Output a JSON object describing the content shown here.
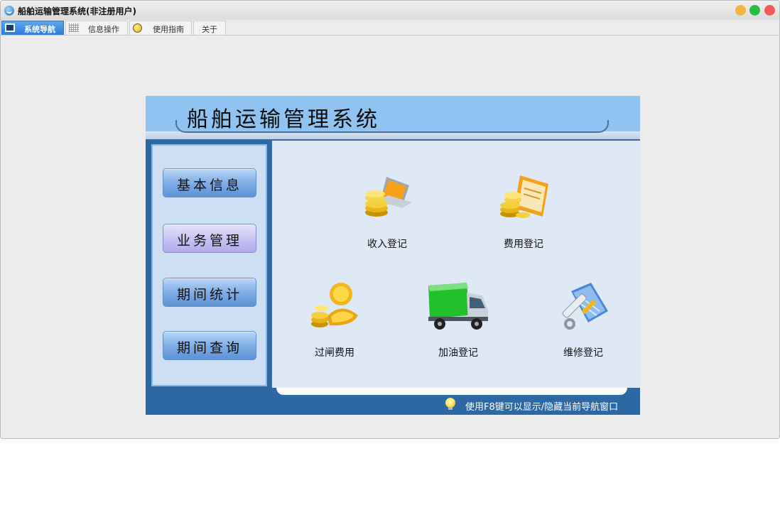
{
  "window": {
    "title": "船舶运输管理系统(非注册用户)"
  },
  "tabs": [
    {
      "label": "系统导航",
      "icon": "monitor-icon",
      "active": true
    },
    {
      "label": "信息操作",
      "icon": "grid-icon",
      "active": false
    },
    {
      "label": "使用指南",
      "icon": "help-icon",
      "active": false
    },
    {
      "label": "关于",
      "icon": "",
      "active": false
    }
  ],
  "banner": {
    "title": "船舶运输管理系统"
  },
  "sidebar": {
    "items": [
      {
        "label": "基本信息",
        "selected": false
      },
      {
        "label": "业务管理",
        "selected": true
      },
      {
        "label": "期间统计",
        "selected": false
      },
      {
        "label": "期间查询",
        "selected": false
      }
    ]
  },
  "functions": [
    {
      "label": "收入登记",
      "icon": "laptop-coins-icon"
    },
    {
      "label": "费用登记",
      "icon": "coins-document-icon"
    },
    {
      "label": "过闸费用",
      "icon": "gold-coins-icon"
    },
    {
      "label": "加油登记",
      "icon": "truck-icon"
    },
    {
      "label": "维修登记",
      "icon": "wrench-document-icon"
    }
  ],
  "footer": {
    "hint": "使用F8键可以显示/隐藏当前导航窗口",
    "icon": "lightbulb-icon"
  },
  "colors": {
    "accent": "#2a7ddb",
    "panel_blue": "#2b68a4",
    "banner_blue": "#8fc3f2",
    "content_bg": "#dfe8f5"
  }
}
